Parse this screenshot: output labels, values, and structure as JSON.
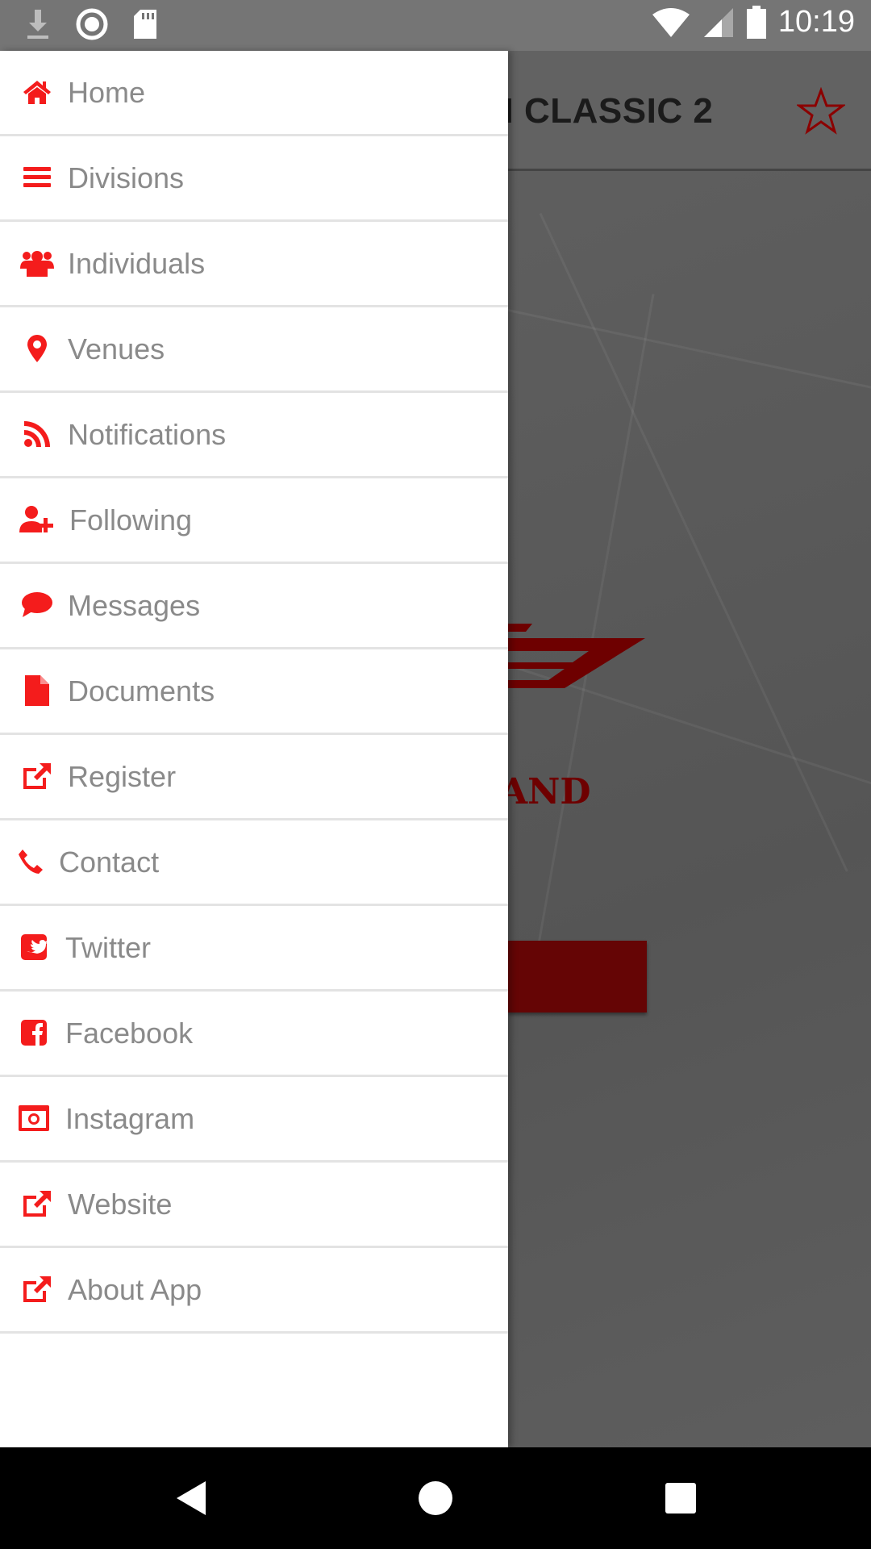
{
  "status_bar": {
    "time": "10:19",
    "icons": [
      "download-icon",
      "sync-circle-icon",
      "sd-card-icon",
      "wifi-icon",
      "cell-signal-icon",
      "battery-icon"
    ]
  },
  "app_bar": {
    "title_visible": "N CLASSIC 2",
    "favorite_icon": "star-outline-icon"
  },
  "background": {
    "logo_text_visible": "AND"
  },
  "accent_color": "#f41c1c",
  "drawer": {
    "items": [
      {
        "label": "Home",
        "icon": "home-icon"
      },
      {
        "label": "Divisions",
        "icon": "bars-icon"
      },
      {
        "label": "Individuals",
        "icon": "users-icon"
      },
      {
        "label": "Venues",
        "icon": "map-marker-icon"
      },
      {
        "label": "Notifications",
        "icon": "rss-icon"
      },
      {
        "label": "Following",
        "icon": "user-plus-icon"
      },
      {
        "label": "Messages",
        "icon": "comment-icon"
      },
      {
        "label": "Documents",
        "icon": "file-icon"
      },
      {
        "label": "Register",
        "icon": "external-link-icon"
      },
      {
        "label": "Contact",
        "icon": "phone-icon"
      },
      {
        "label": "Twitter",
        "icon": "twitter-square-icon"
      },
      {
        "label": "Facebook",
        "icon": "facebook-square-icon"
      },
      {
        "label": "Instagram",
        "icon": "instagram-icon"
      },
      {
        "label": "Website",
        "icon": "external-link-icon"
      },
      {
        "label": "About App",
        "icon": "external-link-icon"
      }
    ]
  },
  "nav_bar": {
    "buttons": [
      "back-icon",
      "home-circle-icon",
      "recents-square-icon"
    ]
  }
}
